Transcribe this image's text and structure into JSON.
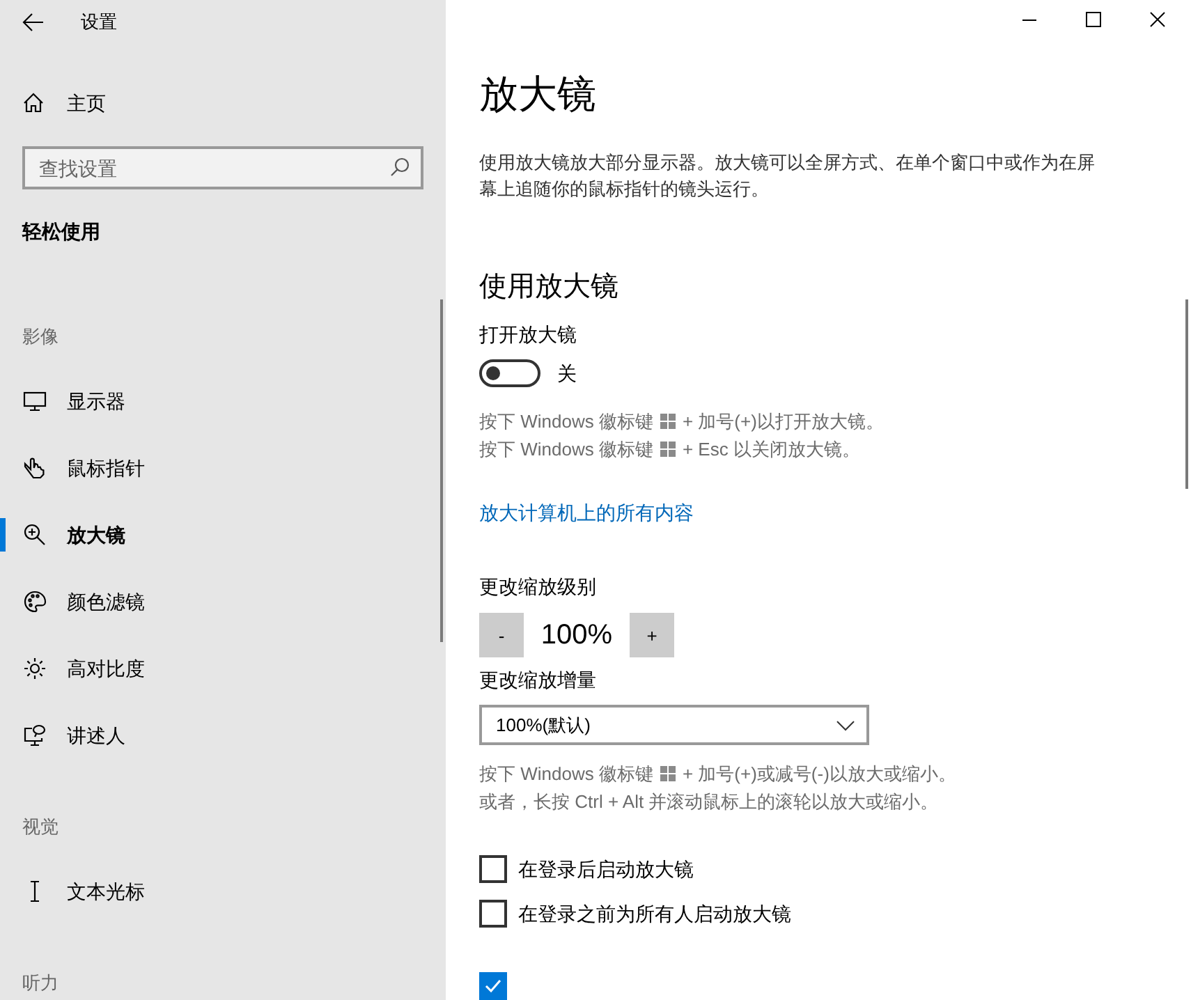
{
  "window": {
    "title": "设置"
  },
  "sidebar": {
    "home": "主页",
    "search": {
      "placeholder": "查找设置"
    },
    "category": "轻松使用",
    "sections": [
      {
        "heading": "影像",
        "items": [
          {
            "label": "显示器",
            "selected": false
          },
          {
            "label": "鼠标指针",
            "selected": false
          },
          {
            "label": "放大镜",
            "selected": true
          },
          {
            "label": "颜色滤镜",
            "selected": false
          },
          {
            "label": "高对比度",
            "selected": false
          },
          {
            "label": "讲述人",
            "selected": false
          }
        ]
      },
      {
        "heading": "视觉",
        "items": [
          {
            "label": "文本光标",
            "selected": false
          }
        ]
      },
      {
        "heading": "听力"
      }
    ]
  },
  "main": {
    "title": "放大镜",
    "description": "使用放大镜放大部分显示器。放大镜可以全屏方式、在单个窗口中或作为在屏幕上追随你的鼠标指针的镜头运行。",
    "section": "使用放大镜",
    "toggle": {
      "label": "打开放大镜",
      "on": false,
      "state_text": "关"
    },
    "shortcut_lines": [
      {
        "kind": "win-key",
        "before": "按下 Windows 徽标键",
        "after": "+ 加号(+)以打开放大镜。"
      },
      {
        "kind": "win-key",
        "before": "按下 Windows 徽标键",
        "after": "+ Esc 以关闭放大镜。"
      }
    ],
    "link": "放大计算机上的所有内容",
    "zoom": {
      "label": "更改缩放级别",
      "minus": "-",
      "value": "100%",
      "plus": "+"
    },
    "increment": {
      "label": "更改缩放增量",
      "value": "100%(默认)"
    },
    "zoom_help": [
      {
        "kind": "win-key",
        "before": "按下 Windows 徽标键",
        "after": "+ 加号(+)或减号(-)以放大或缩小。"
      },
      {
        "kind": "plain",
        "before": "或者，长按 Ctrl + Alt 并滚动鼠标上的滚轮以放大或缩小。"
      }
    ],
    "checkboxes": [
      {
        "label": "在登录后启动放大镜",
        "checked": false
      },
      {
        "label": "在登录之前为所有人启动放大镜",
        "checked": false
      },
      {
        "checked": true
      }
    ]
  }
}
